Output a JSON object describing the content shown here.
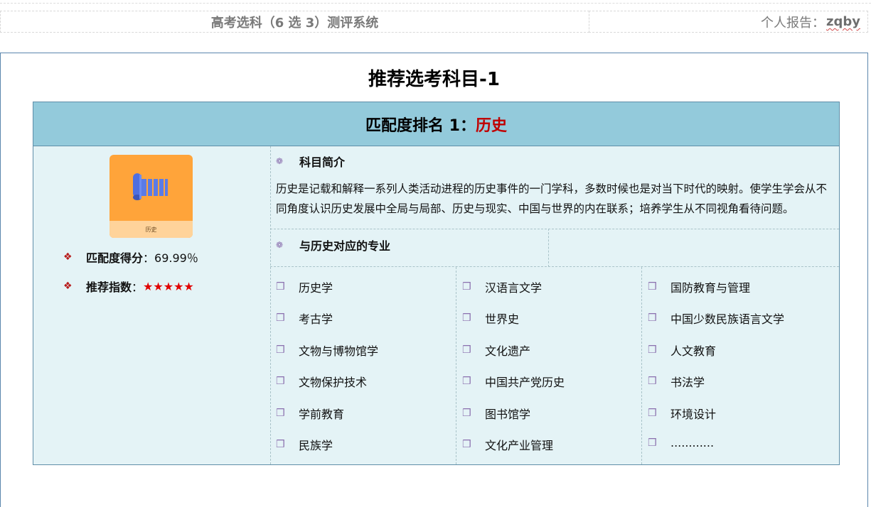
{
  "header": {
    "title": "高考选科（6 选 3）测评系统",
    "report_label": "个人报告：",
    "user": "zqby"
  },
  "page": {
    "title": "推荐选考科目-1"
  },
  "card": {
    "rank_label": "匹配度排名 1：",
    "subject": "历史",
    "thumb_caption": "历史",
    "match_label": "匹配度得分",
    "match_sep": "：",
    "match_value": "69.99％",
    "recommend_label": "推荐指数",
    "recommend_sep": "：",
    "recommend_stars": "★★★★★",
    "icon_colors": {
      "tile": "#ffa43a",
      "band": "#ffd39a",
      "scroll": "#4f6fe0"
    }
  },
  "intro": {
    "heading": "科目简介",
    "text": "历史是记载和解释一系列人类活动进程的历史事件的一门学科，多数时候也是对当下时代的映射。使学生学会从不同角度认识历史发展中全局与局部、历史与现实、中国与世界的内在联系；培养学生从不同视角看待问题。"
  },
  "majors": {
    "heading": "与历史对应的专业",
    "columns": [
      [
        "历史学",
        "考古学",
        "文物与博物馆学",
        "文物保护技术",
        "学前教育",
        "民族学"
      ],
      [
        "汉语言文学",
        "世界史",
        "文化遗产",
        "中国共产党历史",
        "图书馆学",
        "文化产业管理"
      ],
      [
        "国防教育与管理",
        "中国少数民族语言文学",
        "人文教育",
        "书法学",
        "环境设计",
        "............"
      ]
    ]
  }
}
